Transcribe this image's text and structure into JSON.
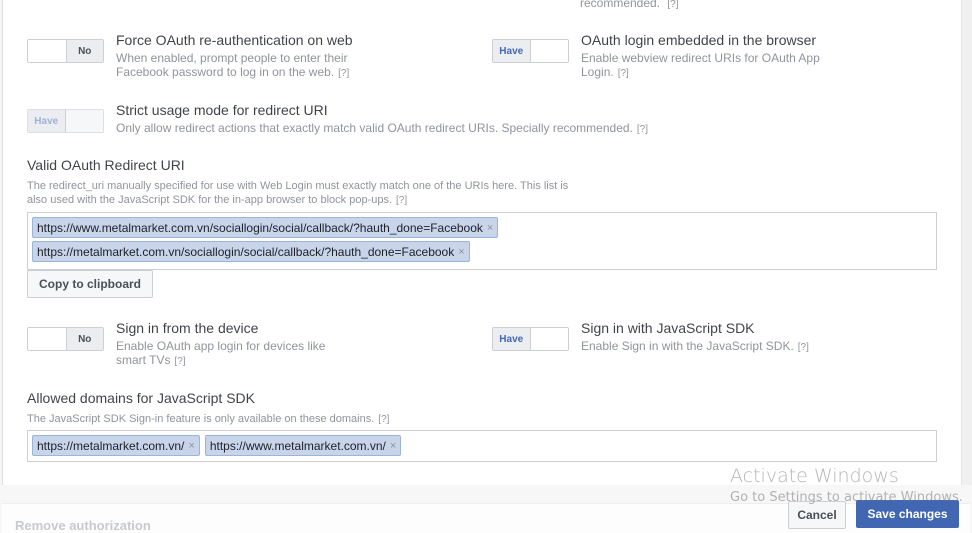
{
  "top_fragment": {
    "text": "recommended.",
    "help": "[?]"
  },
  "settings": [
    {
      "id": "force-reauth",
      "title": "Force OAuth re-authentication on web",
      "desc_lines": [
        "When enabled, prompt people to enter their",
        "Facebook password to log in on the web."
      ],
      "help": "[?]",
      "toggle_label": "No",
      "state": "off",
      "disabled": false
    },
    {
      "id": "embedded-browser",
      "title": "OAuth login embedded in the browser",
      "desc_lines": [
        "Enable webview redirect URIs for OAuth App",
        "Login."
      ],
      "help": "[?]",
      "toggle_label": "Have",
      "state": "on",
      "disabled": false
    },
    {
      "id": "strict-mode",
      "title": "Strict usage mode for redirect URI",
      "desc_lines": [
        "Only allow redirect actions that exactly match valid OAuth redirect URIs. Specially recommended."
      ],
      "help": "[?]",
      "toggle_label": "Have",
      "state": "on",
      "disabled": true
    },
    {
      "id": "device-login",
      "title": "Sign in from the device",
      "desc_lines": [
        "Enable OAuth app login for devices like",
        "smart TVs"
      ],
      "help": "[?]",
      "toggle_label": "No",
      "state": "off",
      "disabled": false
    },
    {
      "id": "js-sdk-login",
      "title": "Sign in with JavaScript SDK",
      "desc_lines": [
        "Enable Sign in with the JavaScript SDK."
      ],
      "help": "[?]",
      "toggle_label": "Have",
      "state": "on",
      "disabled": false
    }
  ],
  "redirect_uri": {
    "title": "Valid OAuth Redirect URI",
    "desc_lines": [
      "The redirect_uri manually specified for use with Web Login must exactly match one of the URIs here. This list is",
      "also used with the JavaScript SDK for the in-app browser to block pop-ups."
    ],
    "help": "[?]",
    "tokens": [
      "https://www.metalmarket.com.vn/sociallogin/social/callback/?hauth_done=Facebook",
      "https://metalmarket.com.vn/sociallogin/social/callback/?hauth_done=Facebook"
    ],
    "copy_label": "Copy to clipboard"
  },
  "allowed_domains": {
    "title": "Allowed domains for JavaScript SDK",
    "desc": "The JavaScript SDK Sign-in feature is only available on these domains.",
    "help": "[?]",
    "tokens": [
      "https://metalmarket.com.vn/",
      "https://www.metalmarket.com.vn/"
    ]
  },
  "footer": {
    "remove_label": "Remove authorization",
    "cancel_label": "Cancel",
    "save_label": "Save changes"
  },
  "watermark": {
    "line1": "Activate Windows",
    "line2": "Go to Settings to activate Windows."
  },
  "token_remove_glyph": "×",
  "colors": {
    "accent": "#4267b2",
    "token_bg": "#c7d4ea",
    "token_border": "#9cb4d8"
  }
}
